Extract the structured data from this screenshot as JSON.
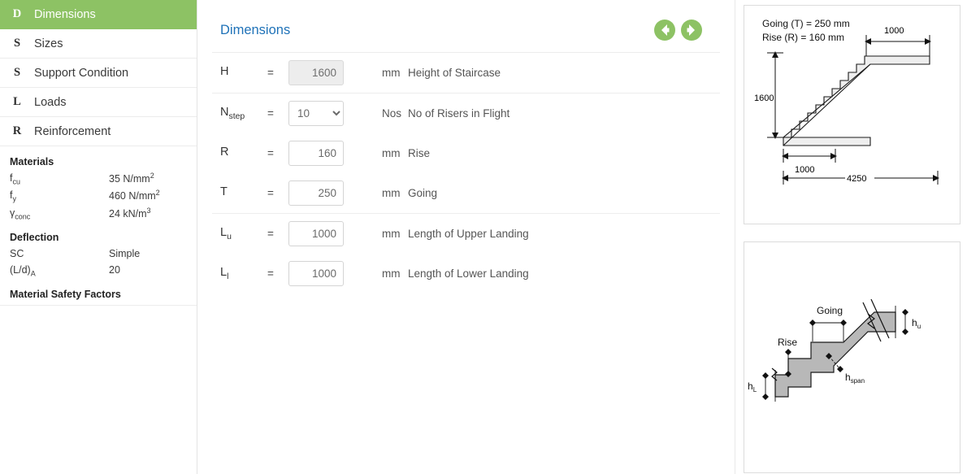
{
  "sidebar": {
    "items": [
      {
        "letter": "D",
        "label": "Dimensions",
        "active": true
      },
      {
        "letter": "S",
        "label": "Sizes",
        "active": false
      },
      {
        "letter": "S",
        "label": "Support Condition",
        "active": false
      },
      {
        "letter": "L",
        "label": "Loads",
        "active": false
      },
      {
        "letter": "R",
        "label": "Reinforcement",
        "active": false
      }
    ],
    "materials": {
      "heading": "Materials",
      "rows": [
        {
          "key_main": "f",
          "key_sub": "cu",
          "value_num": "35 N/mm",
          "value_sup": "2"
        },
        {
          "key_main": "f",
          "key_sub": "y",
          "value_num": "460 N/mm",
          "value_sup": "2"
        },
        {
          "key_main": "γ",
          "key_sub": "conc",
          "value_num": "24 kN/m",
          "value_sup": "3"
        }
      ]
    },
    "deflection": {
      "heading": "Deflection",
      "rows": [
        {
          "key": "SC",
          "value": "Simple"
        },
        {
          "key_main": "(L/d)",
          "key_sub": "A",
          "value": "20"
        }
      ]
    },
    "safety_heading": "Material Safety Factors"
  },
  "main": {
    "title": "Dimensions",
    "nav": {
      "prev": "previous-step",
      "next": "next-step"
    },
    "groups": [
      {
        "rows": [
          {
            "symbol_main": "H",
            "symbol_sub": "",
            "equals": "=",
            "control": "input",
            "value": "1600",
            "disabled": true,
            "unit": "mm",
            "description": "Height of Staircase"
          }
        ]
      },
      {
        "rows": [
          {
            "symbol_main": "N",
            "symbol_sub": "step",
            "equals": "=",
            "control": "select",
            "value": "10",
            "disabled": false,
            "options": [
              "10"
            ],
            "unit": "Nos",
            "description": "No of Risers in Flight"
          },
          {
            "symbol_main": "R",
            "symbol_sub": "",
            "equals": "=",
            "control": "input",
            "value": "160",
            "disabled": false,
            "unit": "mm",
            "description": "Rise"
          },
          {
            "symbol_main": "T",
            "symbol_sub": "",
            "equals": "=",
            "control": "input",
            "value": "250",
            "disabled": false,
            "unit": "mm",
            "description": "Going"
          }
        ]
      },
      {
        "rows": [
          {
            "symbol_main": "L",
            "symbol_sub": "u",
            "equals": "=",
            "control": "input",
            "value": "1000",
            "disabled": false,
            "unit": "mm",
            "description": "Length of Upper Landing"
          },
          {
            "symbol_main": "L",
            "symbol_sub": "l",
            "equals": "=",
            "control": "input",
            "value": "1000",
            "disabled": false,
            "unit": "mm",
            "description": "Length of Lower Landing"
          }
        ]
      }
    ]
  },
  "diagram_elevation": {
    "note_line1": "Going (T) = 250 mm",
    "note_line2": "Rise   (R) = 160 mm",
    "dim_height": "1600",
    "dim_upper_landing": "1000",
    "dim_lower_landing": "1000",
    "dim_total_length": "4250",
    "steps": 10
  },
  "diagram_section": {
    "label_going": "Going",
    "label_rise": "Rise",
    "label_hu_main": "h",
    "label_hu_sub": "u",
    "label_hl_main": "h",
    "label_hl_sub": "L",
    "label_hspan_main": "h",
    "label_hspan_sub": "span"
  },
  "colors": {
    "accent_green": "#8dc264",
    "title_blue": "#1f72b8",
    "border_gray": "#e4e4e4",
    "disabled_fill": "#ededed",
    "diagram_fill": "#efefef",
    "section_fill": "#bfbfbf"
  }
}
